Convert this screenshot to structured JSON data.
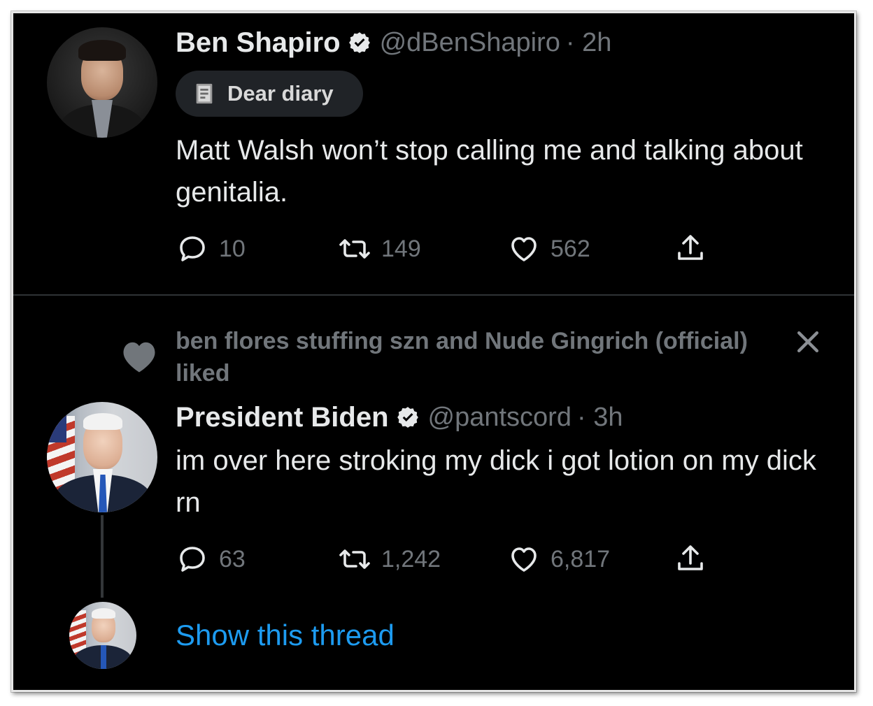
{
  "colors": {
    "background": "#000000",
    "text_primary": "#e7e9ea",
    "text_secondary": "#71767b",
    "link": "#1d9bf0",
    "divider": "#2f3336"
  },
  "tweet1": {
    "author": {
      "display_name": "Ben Shapiro",
      "handle": "@dBenShapiro",
      "timestamp": "· 2h",
      "verified": true
    },
    "pill": {
      "label": "Dear diary",
      "icon": "notebook-icon"
    },
    "text": "Matt Walsh won’t stop calling me and talking about genitalia.",
    "actions": {
      "replies": "10",
      "retweets": "149",
      "likes": "562"
    }
  },
  "tweet2": {
    "social_context": "ben flores stuffing szn and Nude Gingrich (official) liked",
    "author": {
      "display_name": "President Biden",
      "handle": "@pantscord",
      "timestamp": "· 3h",
      "verified": true
    },
    "text": "im over here stroking my dick i got lotion on my dick rn",
    "actions": {
      "replies": "63",
      "retweets": "1,242",
      "likes": "6,817"
    }
  },
  "thread": {
    "show_label": "Show this thread"
  },
  "icons": [
    "verified-badge-icon",
    "reply-icon",
    "retweet-icon",
    "like-icon",
    "share-icon",
    "close-icon",
    "heart-icon"
  ]
}
